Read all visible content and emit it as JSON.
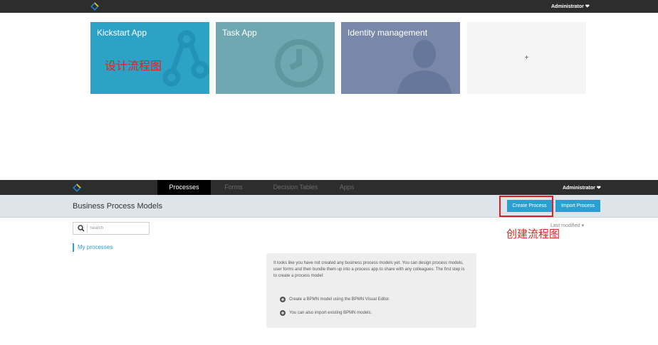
{
  "top_app": {
    "user_menu": "Administrator ❤",
    "tiles": [
      {
        "title": "Kickstart App",
        "color": "#2ca2c6"
      },
      {
        "title": "Task App",
        "color": "#6fa8b0"
      },
      {
        "title": "Identity management",
        "color": "#7988a8"
      },
      {
        "title": "+",
        "color": "#f5f5f5"
      }
    ],
    "annotation": "设计流程图"
  },
  "editor": {
    "user_menu": "Administrator ❤",
    "nav_tabs": [
      "Processes",
      "Forms",
      "Decision Tables",
      "Apps"
    ],
    "active_tab": "Processes",
    "page_title": "Business Process Models",
    "create_button": "Create Process",
    "import_button": "Import Process",
    "annotation": "创建流程图",
    "search_placeholder": "Search",
    "sort_label": "Last modified ▾",
    "filter_item": "My processes",
    "empty_message": "It looks like you have not created any business process models yet. You can design process models, user forms and then bundle them up into a process app to share with any colleagues. The first step is to create a process model:",
    "hints": [
      "Create a BPMN model using the BPMN Visual Editor.",
      "You can also import existing BPMN models."
    ]
  },
  "colors": {
    "accent": "#2c9fd1",
    "topbar": "#2d2d2d",
    "annotation_red": "#e02020"
  }
}
